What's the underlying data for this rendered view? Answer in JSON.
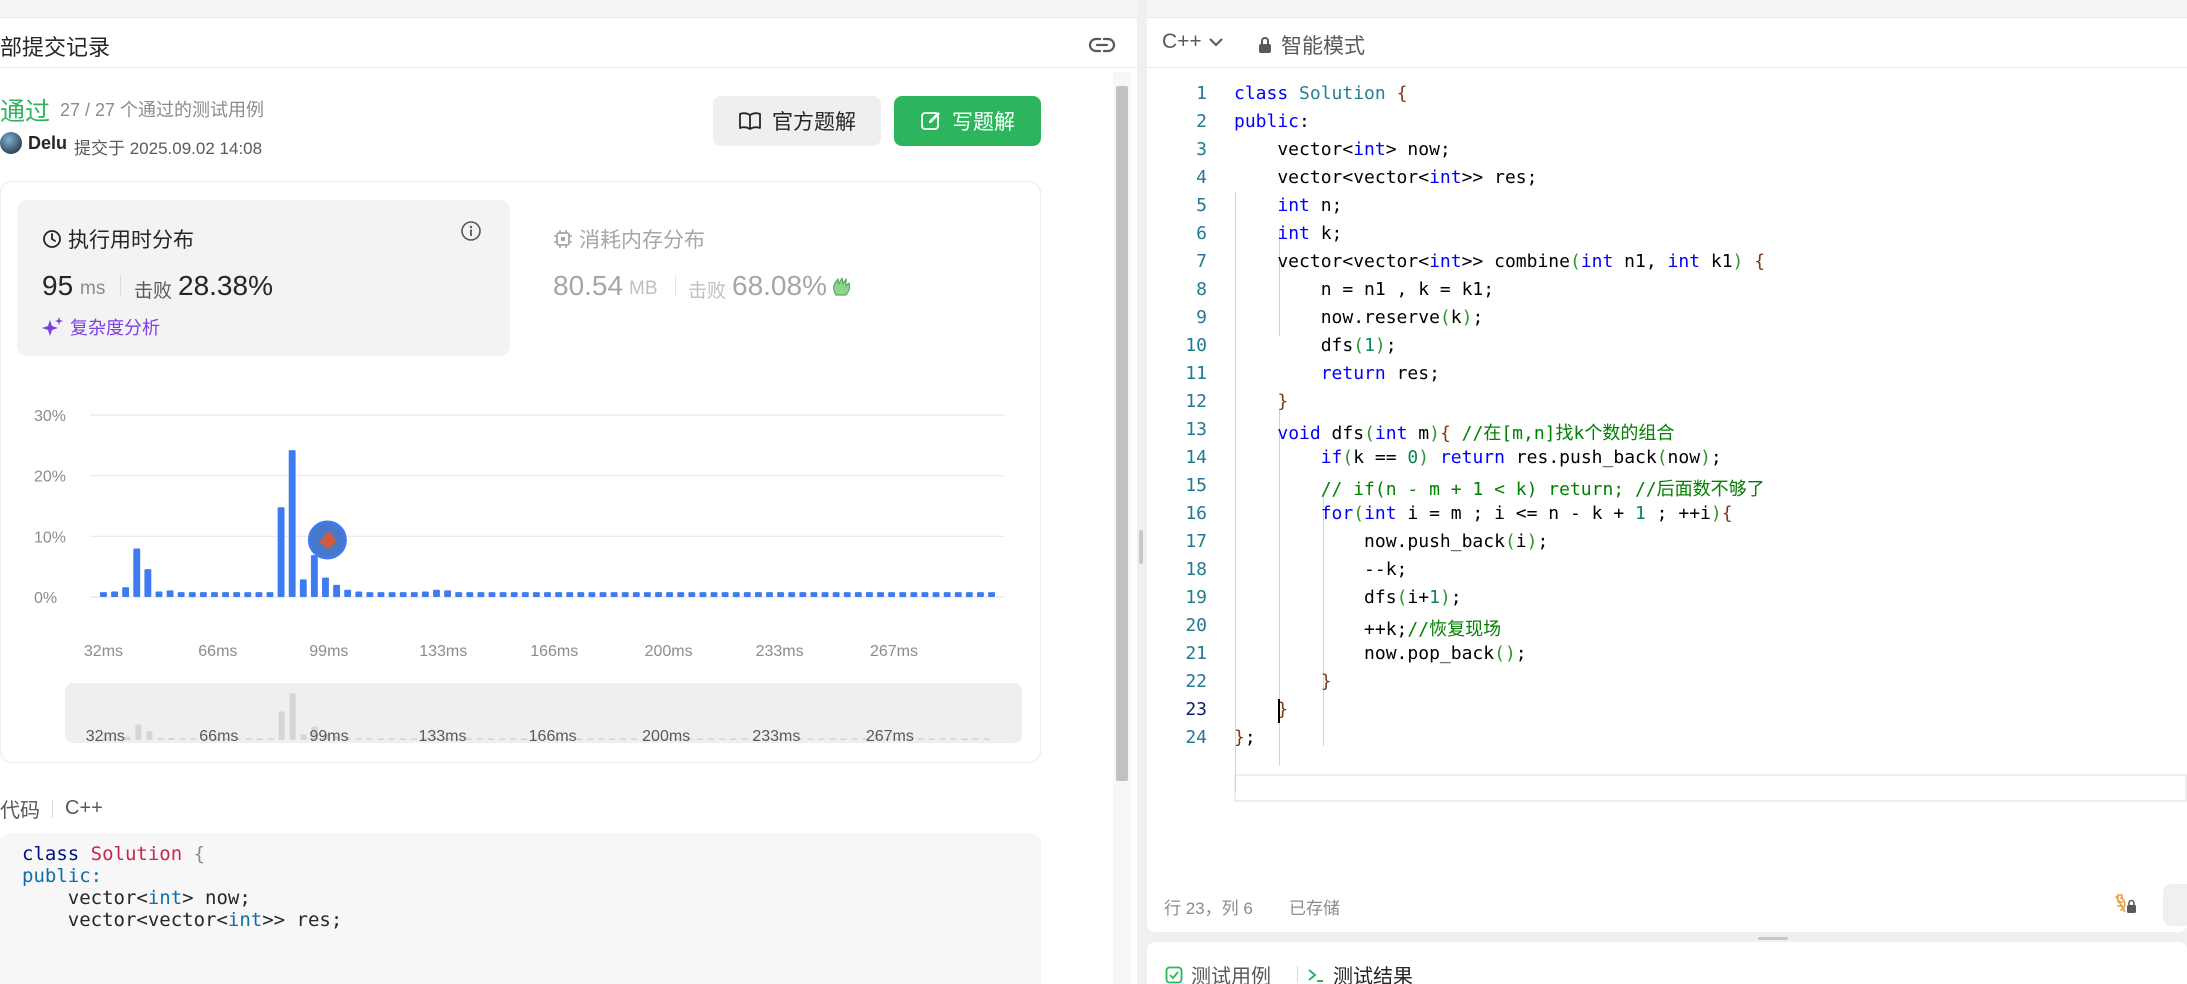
{
  "left_panel": {
    "title": "部提交记录",
    "status": "通过",
    "cases": "27 / 27 个通过的测试用例",
    "author": "Delu",
    "submitted": "提交于 2025.09.02 14:08",
    "btn_official": "官方题解",
    "btn_write": "写题解",
    "runtime": {
      "title": "执行用时分布",
      "value": "95",
      "unit": "ms",
      "beat_label": "击败",
      "beat": "28.38%",
      "analysis": "复杂度分析"
    },
    "memory": {
      "title": "消耗内存分布",
      "value": "80.54",
      "unit": "MB",
      "beat_label": "击败",
      "beat": "68.08%"
    },
    "code_label": "代码",
    "code_lang": "C++",
    "code_preview": [
      "class Solution {",
      "public:",
      "    vector<int> now;",
      "    vector<vector<int>> res;"
    ]
  },
  "chart_data": {
    "type": "bar",
    "xlabel": "",
    "ylabel": "",
    "y_ticks": [
      "30%",
      "20%",
      "10%",
      "0%"
    ],
    "ylim": [
      0,
      30
    ],
    "x_ticks": [
      "32ms",
      "66ms",
      "99ms",
      "133ms",
      "166ms",
      "200ms",
      "233ms",
      "267ms"
    ],
    "x_tick_values": [
      32,
      66,
      99,
      133,
      166,
      200,
      233,
      267
    ],
    "x_range": [
      28,
      300
    ],
    "bar_width_ms": 3.3,
    "highlight_value": 95,
    "colors": {
      "bar": "#3e7bf0",
      "bar_mini": "#d5d5d5",
      "grid": "#e8e8e8"
    },
    "bars": [
      {
        "x": 32,
        "y": 0.8
      },
      {
        "x": 35.3,
        "y": 0.9
      },
      {
        "x": 38.6,
        "y": 1.6
      },
      {
        "x": 41.9,
        "y": 8.0
      },
      {
        "x": 45.2,
        "y": 4.6
      },
      {
        "x": 48.5,
        "y": 0.9
      },
      {
        "x": 51.8,
        "y": 1.1
      },
      {
        "x": 55.1,
        "y": 0.8
      },
      {
        "x": 58.4,
        "y": 0.8
      },
      {
        "x": 61.7,
        "y": 0.8
      },
      {
        "x": 65.0,
        "y": 0.8
      },
      {
        "x": 68.3,
        "y": 0.8
      },
      {
        "x": 71.6,
        "y": 0.8
      },
      {
        "x": 74.9,
        "y": 0.8
      },
      {
        "x": 78.2,
        "y": 0.8
      },
      {
        "x": 81.5,
        "y": 0.8
      },
      {
        "x": 84.8,
        "y": 14.8
      },
      {
        "x": 88.1,
        "y": 24.2
      },
      {
        "x": 91.4,
        "y": 2.9
      },
      {
        "x": 94.7,
        "y": 6.9
      },
      {
        "x": 98.0,
        "y": 3.2
      },
      {
        "x": 101.3,
        "y": 2.0
      },
      {
        "x": 104.6,
        "y": 1.2
      },
      {
        "x": 107.9,
        "y": 0.9
      },
      {
        "x": 111.2,
        "y": 0.8
      },
      {
        "x": 114.5,
        "y": 0.8
      },
      {
        "x": 117.8,
        "y": 0.8
      },
      {
        "x": 121.1,
        "y": 0.8
      },
      {
        "x": 124.4,
        "y": 0.8
      },
      {
        "x": 127.7,
        "y": 0.9
      },
      {
        "x": 131.0,
        "y": 1.2
      },
      {
        "x": 134.3,
        "y": 1.1
      },
      {
        "x": 137.6,
        "y": 0.8
      },
      {
        "x": 140.9,
        "y": 0.8
      },
      {
        "x": 144.2,
        "y": 0.8
      },
      {
        "x": 147.5,
        "y": 0.8
      },
      {
        "x": 150.8,
        "y": 0.8
      },
      {
        "x": 154.1,
        "y": 0.8
      },
      {
        "x": 157.4,
        "y": 0.8
      },
      {
        "x": 160.7,
        "y": 0.8
      },
      {
        "x": 164.0,
        "y": 0.8
      },
      {
        "x": 167.3,
        "y": 0.8
      },
      {
        "x": 170.6,
        "y": 0.8
      },
      {
        "x": 173.9,
        "y": 0.8
      },
      {
        "x": 177.2,
        "y": 0.8
      },
      {
        "x": 180.5,
        "y": 0.8
      },
      {
        "x": 183.8,
        "y": 0.8
      },
      {
        "x": 187.1,
        "y": 0.8
      },
      {
        "x": 190.4,
        "y": 0.8
      },
      {
        "x": 193.7,
        "y": 0.8
      },
      {
        "x": 197.0,
        "y": 0.8
      },
      {
        "x": 200.3,
        "y": 0.8
      },
      {
        "x": 203.6,
        "y": 0.8
      },
      {
        "x": 206.9,
        "y": 0.8
      },
      {
        "x": 210.2,
        "y": 0.8
      },
      {
        "x": 213.5,
        "y": 0.8
      },
      {
        "x": 216.8,
        "y": 0.8
      },
      {
        "x": 220.1,
        "y": 0.8
      },
      {
        "x": 223.4,
        "y": 0.8
      },
      {
        "x": 226.7,
        "y": 0.8
      },
      {
        "x": 230.0,
        "y": 0.8
      },
      {
        "x": 233.3,
        "y": 0.8
      },
      {
        "x": 236.6,
        "y": 0.8
      },
      {
        "x": 239.9,
        "y": 0.8
      },
      {
        "x": 243.2,
        "y": 0.8
      },
      {
        "x": 246.5,
        "y": 0.8
      },
      {
        "x": 249.8,
        "y": 0.8
      },
      {
        "x": 253.1,
        "y": 0.8
      },
      {
        "x": 256.4,
        "y": 0.8
      },
      {
        "x": 259.7,
        "y": 0.8
      },
      {
        "x": 263.0,
        "y": 0.8
      },
      {
        "x": 266.3,
        "y": 0.8
      },
      {
        "x": 269.6,
        "y": 0.8
      },
      {
        "x": 272.9,
        "y": 0.8
      },
      {
        "x": 276.2,
        "y": 0.8
      },
      {
        "x": 279.5,
        "y": 0.8
      },
      {
        "x": 282.8,
        "y": 0.8
      },
      {
        "x": 286.1,
        "y": 0.8
      },
      {
        "x": 289.4,
        "y": 0.8
      },
      {
        "x": 292.7,
        "y": 0.8
      },
      {
        "x": 296.0,
        "y": 0.8
      }
    ]
  },
  "editor": {
    "lang": "C++",
    "smart_mode": "智能模式",
    "active_line": 23,
    "line_numbers": [
      "1",
      "2",
      "3",
      "4",
      "5",
      "6",
      "7",
      "8",
      "9",
      "10",
      "11",
      "12",
      "13",
      "14",
      "15",
      "16",
      "17",
      "18",
      "19",
      "20",
      "21",
      "22",
      "23",
      "24"
    ],
    "lines": [
      "class Solution {",
      "public:",
      "    vector<int> now;",
      "    vector<vector<int>> res;",
      "    int n;",
      "    int k;",
      "    vector<vector<int>> combine(int n1, int k1) {",
      "        n = n1 , k = k1;",
      "        now.reserve(k);",
      "        dfs(1);",
      "        return res;",
      "    }",
      "    void dfs(int m){ //在[m,n]找k个数的组合",
      "        if(k == 0) return res.push_back(now);",
      "        // if(n - m + 1 < k) return; //后面数不够了",
      "        for(int i = m ; i <= n - k + 1 ; ++i){",
      "            now.push_back(i);",
      "            --k;",
      "            dfs(i+1);",
      "            ++k;//恢复现场",
      "            now.pop_back();",
      "        }",
      "    }",
      "};"
    ],
    "cursor_pos": "行 23，列 6",
    "saved": "已存储"
  },
  "bottom_panel": {
    "tab_cases": "测试用例",
    "tab_result": "测试结果"
  }
}
